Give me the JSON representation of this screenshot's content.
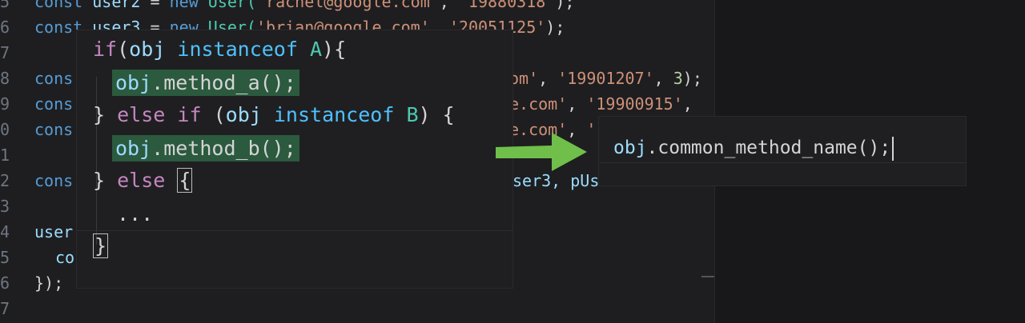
{
  "background_code": {
    "line_numbers": [
      "5",
      "6",
      "7",
      "8",
      "9",
      "0",
      "1",
      "2",
      "3",
      "4",
      "5",
      "6",
      "7"
    ],
    "line5": {
      "decl": "const",
      "name": "user2",
      "op": "=",
      "new": "new",
      "cls": "User(",
      "str1": "'rachel@google.com'",
      "comma": ",",
      "str2": "'19880318'",
      "end": ");"
    },
    "line6": {
      "decl": "const",
      "name": "user3",
      "op": "=",
      "new": "new",
      "cls": "User(",
      "str1": "'brian@google.com'",
      "comma": ",",
      "str2": "'20051125'",
      "end": ");"
    },
    "line8": {
      "decl": "cons",
      "tail_str1": "om'",
      "comma": ",",
      "tail_str2": "'19901207'",
      "num": "3",
      "end": ");"
    },
    "line9": {
      "decl": "cons",
      "tail_str1": "e.com'",
      "comma": ",",
      "tail_str2": "'19900915'",
      "end": ","
    },
    "line10": {
      "decl": "cons",
      "tail_str1": "e.com'",
      "comma": ",",
      "tail_str2": "'"
    },
    "line12": {
      "decl": "cons",
      "tail": "ser3,",
      "tail2": "pUs"
    },
    "line14": {
      "text": "user"
    },
    "line15": {
      "text": "co"
    },
    "line16": {
      "text": "});"
    }
  },
  "popup1": {
    "line1": {
      "if": "if",
      "paren": "(",
      "obj": "obj",
      "instanceof": "instanceof",
      "cls": "A",
      "end": "){"
    },
    "line2": {
      "obj": "obj",
      "method": ".method_a();"
    },
    "line3": {
      "brace": "}",
      "else": "else",
      "if": "if",
      "paren": "(",
      "obj": "obj",
      "instanceof": "instanceof",
      "cls": "B",
      "end": ") {"
    },
    "line4": {
      "obj": "obj",
      "method": ".method_b();"
    },
    "line5": {
      "brace": "}",
      "else": "else",
      "open": "{"
    },
    "line6": {
      "dots": "..."
    },
    "line7": {
      "close": "}"
    }
  },
  "popup2": {
    "obj": "obj",
    "call": ".common_method_name();"
  },
  "colors": {
    "arrow": "#6fbf4a",
    "highlight": "#2b5a3e",
    "keyword": "#c586c0",
    "type": "#4fc1ff",
    "class": "#4ec9b0"
  }
}
